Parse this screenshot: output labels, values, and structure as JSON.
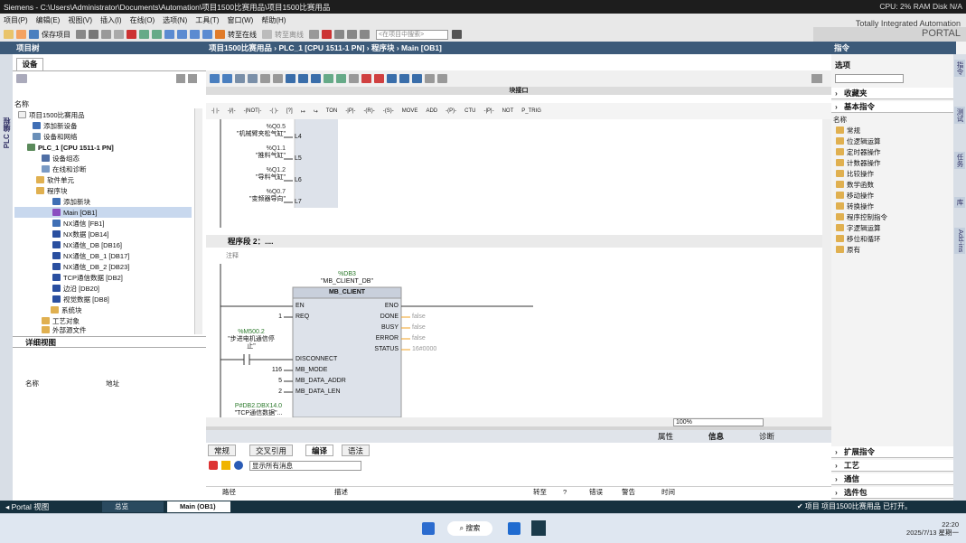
{
  "window": {
    "title": "Siemens - C:\\Users\\Administrator\\Documents\\Automation\\项目1500比赛用品\\项目1500比赛用品",
    "right": "CPU: 2%  RAM  Disk  N/A"
  },
  "menu": [
    "项目(P)",
    "编辑(E)",
    "视图(V)",
    "插入(I)",
    "在线(O)",
    "选项(N)",
    "工具(T)",
    "窗口(W)",
    "帮助(H)"
  ],
  "brand": {
    "line1": "Totally Integrated Automation",
    "line2": "PORTAL"
  },
  "toolbar": {
    "save": "保存项目",
    "go_online": "转至在线",
    "go_offline": "转至离线",
    "search_placeholder": "<在项目中搜索>"
  },
  "left": {
    "title": "项目树",
    "vertical": "PLC 编程",
    "devices_tab": "设备",
    "name_header": "名称",
    "tree": [
      "项目1500比赛用品",
      "添加新设备",
      "设备和网络",
      "PLC_1 [CPU 1511-1 PN]",
      "设备组态",
      "在线和诊断",
      "软件单元",
      "程序块",
      "添加新块",
      "Main [OB1]",
      "NX通信 [FB1]",
      "NX数据 [DB14]",
      "NX通信_DB [DB16]",
      "NX通信_DB_1 [DB17]",
      "NX通信_DB_2 [DB23]",
      "TCP通信数据 [DB2]",
      "边沿 [DB20]",
      "视觉数据 [DB8]",
      "系统块",
      "工艺对象",
      "外部源文件"
    ],
    "detail_title": "详细视图",
    "detail_cols": [
      "名称",
      "地址"
    ]
  },
  "editor": {
    "title": "项目1500比赛用品 › PLC_1 [CPU 1511-1 PN] › 程序块 › Main [OB1]",
    "block_interface": "块接口",
    "ladder_buttons": [
      "TON",
      "MOVE",
      "ADD",
      "CTU",
      "NOT",
      "P_TRIG"
    ],
    "outputs": [
      {
        "addr": "%Q0.5",
        "name": "\"机械臂夹松气缸\"",
        "pin": "L4"
      },
      {
        "addr": "%Q1.1",
        "name": "\"推料气缸\"",
        "pin": "L5"
      },
      {
        "addr": "%Q1.2",
        "name": "\"导料气缸\"",
        "pin": "L6"
      },
      {
        "addr": "%Q0.7",
        "name": "\"变频器导向\"",
        "pin": "L7"
      }
    ],
    "network_title": "程序段 2：....",
    "comment": "注释",
    "instance": {
      "addr": "%DB3",
      "name": "\"MB_CLIENT_DB\""
    },
    "block": {
      "name": "MB_CLIENT",
      "in_pins": [
        "EN",
        "REQ",
        "DISCONNECT",
        "MB_MODE",
        "MB_DATA_ADDR",
        "MB_DATA_LEN"
      ],
      "in_values": [
        "",
        "1",
        "",
        "116",
        "5",
        "2"
      ],
      "out_pins": [
        "ENO",
        "DONE",
        "BUSY",
        "ERROR",
        "STATUS"
      ],
      "out_values": [
        "",
        "false",
        "false",
        "false",
        "16#0000"
      ]
    },
    "contact": {
      "addr": "%M500.2",
      "name": "\"步进电机通信停止\""
    },
    "bottom_tag": {
      "addr": "P#DB2.DBX14.0",
      "name": "\"TCP通信数据\"..."
    },
    "zoom": "100%"
  },
  "properties": {
    "tabs": [
      "属性",
      "信息",
      "诊断"
    ],
    "subtabs": [
      "常规",
      "交叉引用",
      "编译",
      "语法"
    ],
    "filter": "显示所有消息",
    "cols": [
      "路径",
      "描述",
      "转至",
      "?",
      "错误",
      "警告",
      "时间"
    ]
  },
  "right": {
    "title": "指令",
    "options": "选项",
    "favorites": "收藏夹",
    "basic": "基本指令",
    "name_col": "名称",
    "instructions": [
      "常规",
      "位逻辑运算",
      "定时器操作",
      "计数器操作",
      "比较操作",
      "数学函数",
      "移动操作",
      "转换操作",
      "程序控制指令",
      "字逻辑运算",
      "移位和循环",
      "原有"
    ],
    "bottom_sections": [
      "扩展指令",
      "工艺",
      "通信",
      "选件包"
    ],
    "vertical_tabs": [
      "指令",
      "测试",
      "任务",
      "库",
      "Add-ins"
    ]
  },
  "statusbar": {
    "portal_view": "Portal 视图",
    "tabs": [
      "总览",
      "Main (OB1)"
    ],
    "message": "项目 项目1500比赛用品 已打开。"
  },
  "taskbar": {
    "search": "搜索",
    "time": "22:20",
    "date": "2025/7/13 星期一"
  }
}
